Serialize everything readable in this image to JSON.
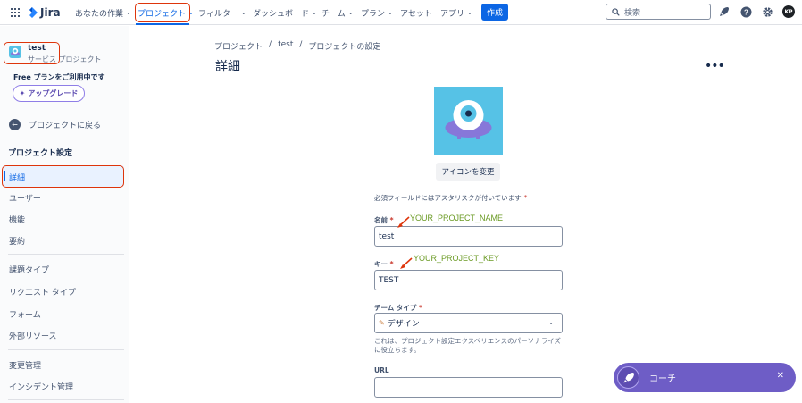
{
  "app": {
    "name": "Jira"
  },
  "nav": {
    "your_work": "あなたの作業",
    "projects": "プロジェクト",
    "filters": "フィルター",
    "dashboards": "ダッシュボード",
    "teams": "チーム",
    "plans": "プラン",
    "assets": "アセット",
    "apps": "アプリ",
    "create": "作成",
    "search_placeholder": "検索",
    "avatar_initials": "KP"
  },
  "sidebar": {
    "project_name": "test",
    "project_type": "サービス プロジェクト",
    "plan_text": "Free プランをご利用中です",
    "upgrade_label": "アップグレード",
    "back_label": "プロジェクトに戻る",
    "settings_heading": "プロジェクト設定",
    "items": [
      "詳細",
      "ユーザー",
      "機能",
      "要約",
      "課題タイプ",
      "リクエスト タイプ",
      "フォーム",
      "外部リソース",
      "変更管理",
      "インシデント管理"
    ]
  },
  "breadcrumb": [
    "プロジェクト",
    "/",
    "test",
    "/",
    "プロジェクトの設定"
  ],
  "page": {
    "title": "詳細",
    "change_icon_label": "アイコンを変更",
    "required_note": "必須フィールドにはアスタリスクが付いています",
    "required_star": "*",
    "name_label": "名前",
    "name_value": "test",
    "key_label": "キー",
    "key_value": "TEST",
    "team_type_label": "チーム タイプ",
    "team_type_value": "デザイン",
    "team_type_helper": "これは、プロジェクト設定エクスペリエンスのパーソナライズに役立ちます。",
    "url_label": "URL",
    "url_value": ""
  },
  "annotations": {
    "name_hint": "YOUR_PROJECT_NAME",
    "key_hint": "YOUR_PROJECT_KEY"
  },
  "coach": {
    "label": "コーチ"
  },
  "colors": {
    "accent": "#0c66e4",
    "highlight": "#de350b",
    "annotation": "#6a9a23",
    "coach": "#6e5dc6"
  }
}
